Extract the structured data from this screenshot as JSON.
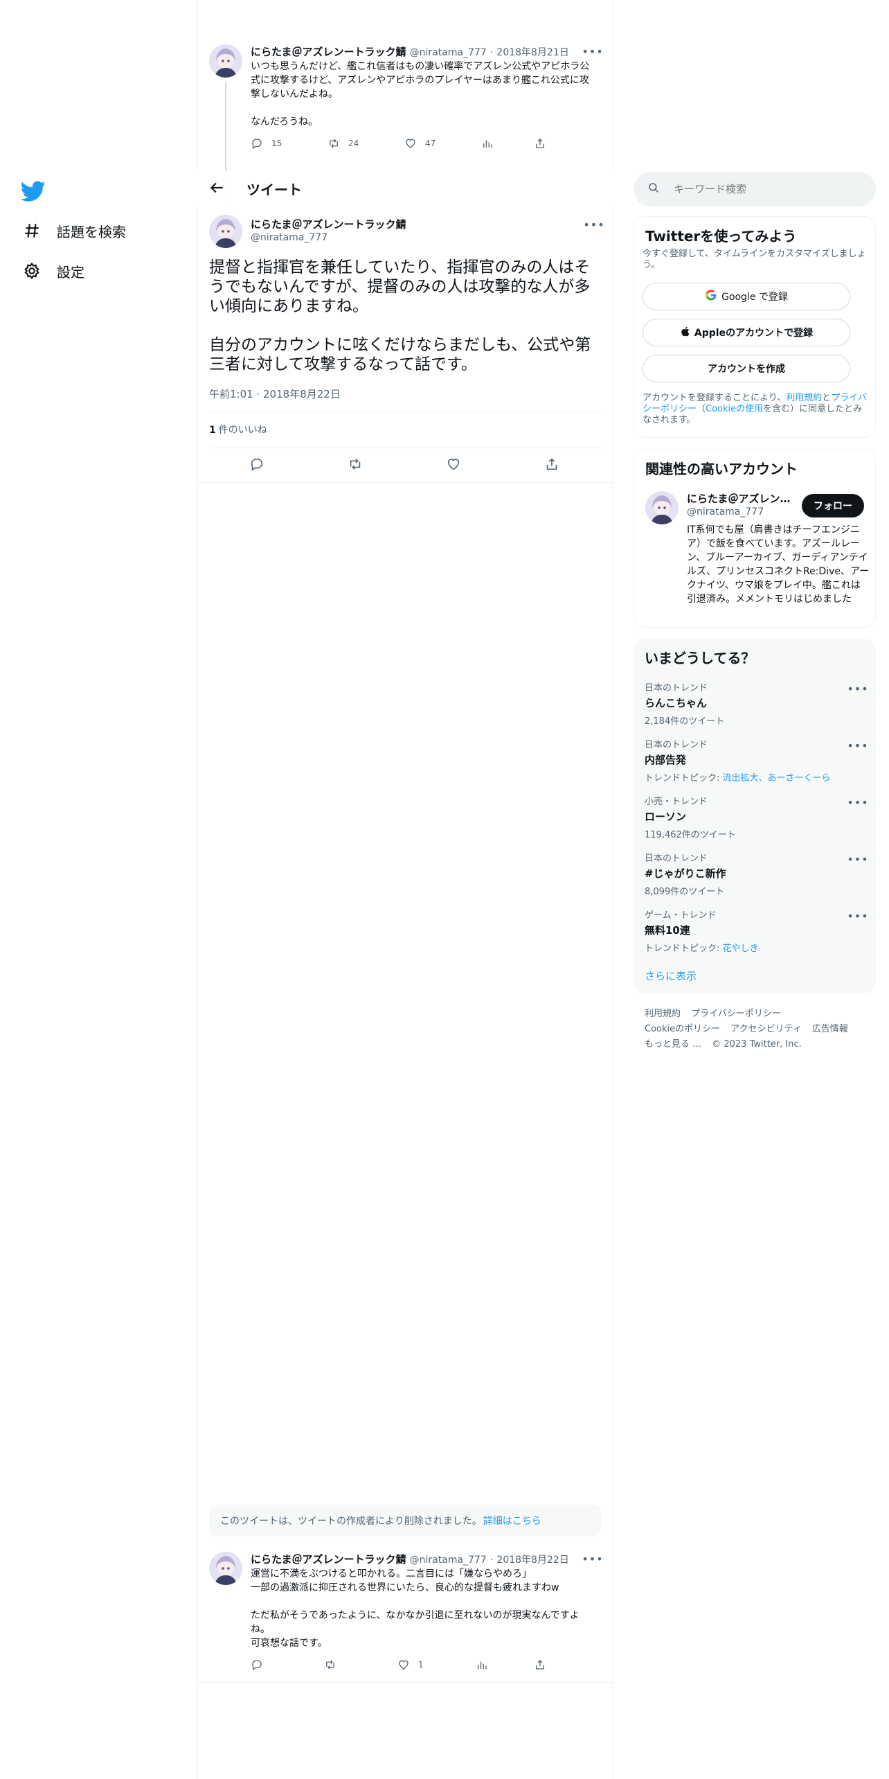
{
  "nav": {
    "items": [
      {
        "label": "話題を検索"
      },
      {
        "label": "設定"
      }
    ]
  },
  "tweet_parent": {
    "name": "にらたま＠アズレンートラック鯖",
    "handle": "@niratama_777",
    "date": "2018年8月21日",
    "text": "いつも思うんだけど、艦これ信者はもの凄い確率でアズレン公式やアピホラ公式に攻撃するけど、アズレンやアピホラのプレイヤーはあまり艦これ公式に攻撃しないんだよね。\n\nなんだろうね。",
    "replies": "15",
    "retweets": "24",
    "likes": "47"
  },
  "header": {
    "title": "ツイート"
  },
  "main_tweet": {
    "name": "にらたま＠アズレンートラック鯖",
    "handle": "@niratama_777",
    "text": "提督と指揮官を兼任していたり、指揮官のみの人はそうでもないんですが、提督のみの人は攻撃的な人が多い傾向にありますね。\n\n自分のアカウントに呟くだけならまだしも、公式や第三者に対して攻撃するなって話です。",
    "time": "午前1:01",
    "date": "2018年8月22日",
    "likes_count": "1",
    "likes_label": "件のいいね"
  },
  "deleted_notice": {
    "text": "このツイートは、ツイートの作成者により削除されました。",
    "link": "詳細はこちら"
  },
  "reply_tweet": {
    "name": "にらたま＠アズレンートラック鯖",
    "handle": "@niratama_777",
    "date": "2018年8月22日",
    "text": "運営に不満をぶつけると叩かれる。二言目には「嫌ならやめろ」\n一部の過激派に抑圧される世界にいたら、良心的な提督も疲れますわw\n\nただ私がそうであったように、なかなか引退に至れないのが現実なんですよね。\n可哀想な話です。",
    "likes": "1"
  },
  "search": {
    "placeholder": "キーワード検索"
  },
  "signup": {
    "title": "Twitterを使ってみよう",
    "subtitle": "今すぐ登録して、タイムラインをカスタマイズしましょう。",
    "google": "Google で登録",
    "apple": "Appleのアカウントで登録",
    "create": "アカウントを作成",
    "legal_prefix": "アカウントを登録することにより、",
    "terms": "利用規約",
    "and": "と",
    "privacy": "プライバシーポリシー",
    "paren_open": "（",
    "cookie": "Cookieの使用",
    "legal_suffix": "を含む）に同意したとみなされます。"
  },
  "related": {
    "title": "関連性の高いアカウント",
    "name": "にらたま＠アズレン…",
    "handle": "@niratama_777",
    "follow": "フォロー",
    "bio": "IT系何でも屋（肩書きはチーフエンジニア）で飯を食べています。アズールレーン、ブルーアーカイブ、ガーディアンテイルズ、プリンセスコネクトRe:Dive、アークナイツ、ウマ娘をプレイ中。艦これは引退済み。メメントモリはじめました"
  },
  "trends": {
    "title": "いまどうしてる？",
    "items": [
      {
        "context": "日本のトレンド",
        "name": "らんこちゃん",
        "meta": "2,184件のツイート",
        "topic_prefix": "",
        "topics": ""
      },
      {
        "context": "日本のトレンド",
        "name": "内部告発",
        "meta": "",
        "topic_prefix": "トレンドトピック: ",
        "topics": "流出拡大、あーさーくーら"
      },
      {
        "context": "小売・トレンド",
        "name": "ローソン",
        "meta": "119,462件のツイート",
        "topic_prefix": "",
        "topics": ""
      },
      {
        "context": "日本のトレンド",
        "name": "#じゃがりこ新作",
        "meta": "8,099件のツイート",
        "topic_prefix": "",
        "topics": ""
      },
      {
        "context": "ゲーム・トレンド",
        "name": "無料10連",
        "meta": "",
        "topic_prefix": "トレンドトピック: ",
        "topics": "花やしき"
      }
    ],
    "show_more": "さらに表示"
  },
  "footer": {
    "terms": "利用規約",
    "privacy": "プライバシーポリシー",
    "cookie": "Cookieのポリシー",
    "accessibility": "アクセシビリティ",
    "ads": "広告情報",
    "more": "もっと見る …",
    "copyright": "© 2023 Twitter, Inc."
  },
  "colors": {
    "accent": "#1d9bf0",
    "text": "#0f1419",
    "secondary": "#536471",
    "border": "#eff3f4"
  }
}
